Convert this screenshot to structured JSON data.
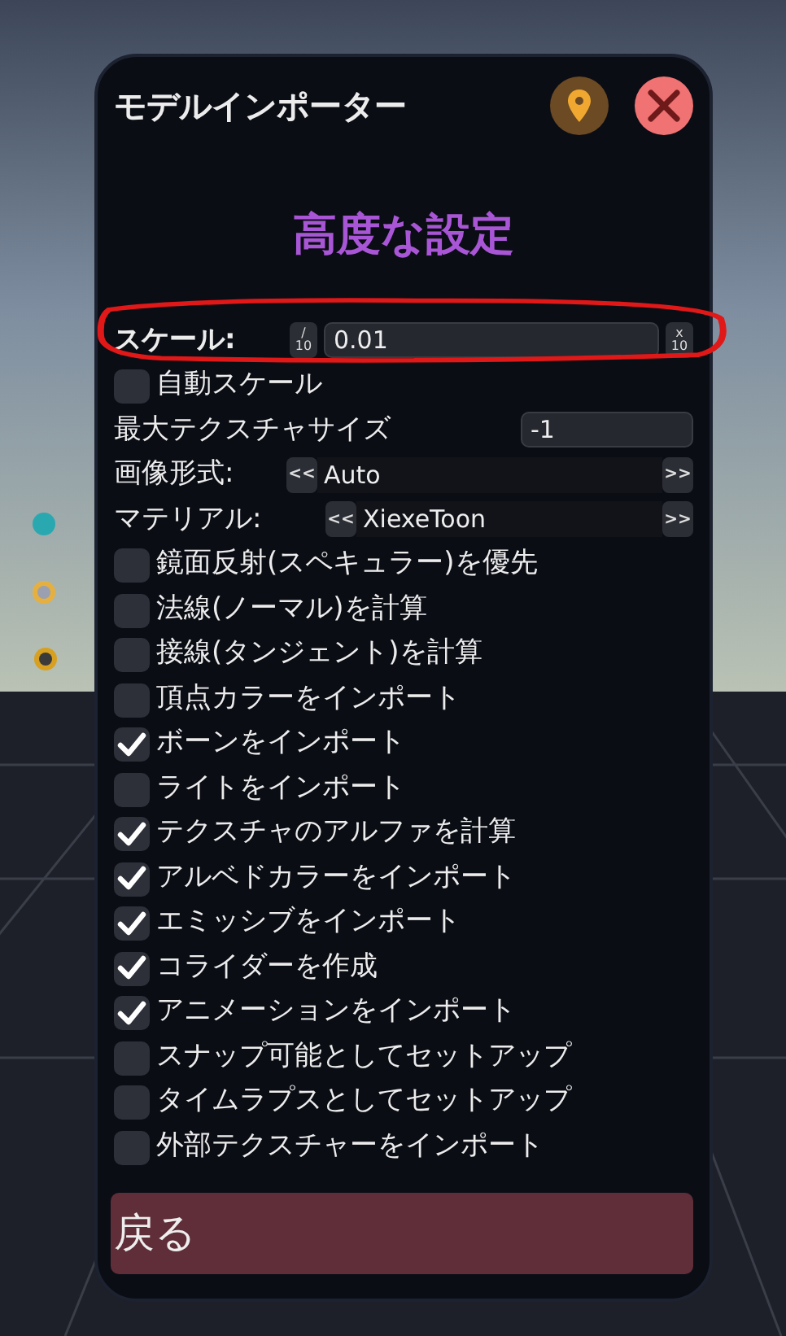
{
  "window": {
    "title": "モデルインポーター"
  },
  "heading": "高度な設定",
  "scale": {
    "label": "スケール:",
    "divide": {
      "symbol": "/",
      "factor": "10"
    },
    "value": "0.01",
    "multiply": {
      "symbol": "x",
      "factor": "10"
    }
  },
  "settings": [
    {
      "kind": "checkbox",
      "label": "自動スケール",
      "checked": false
    },
    {
      "kind": "number",
      "label": "最大テクスチャサイズ",
      "value": "-1"
    },
    {
      "kind": "selector",
      "label": "画像形式:",
      "value": "Auto",
      "prev": "<<",
      "next": ">>"
    },
    {
      "kind": "selector",
      "label": "マテリアル:",
      "value": "XiexeToon",
      "prev": "<<",
      "next": ">>"
    },
    {
      "kind": "checkbox",
      "label": "鏡面反射(スペキュラー)を優先",
      "checked": false
    },
    {
      "kind": "checkbox",
      "label": "法線(ノーマル)を計算",
      "checked": false
    },
    {
      "kind": "checkbox",
      "label": "接線(タンジェント)を計算",
      "checked": false
    },
    {
      "kind": "checkbox",
      "label": "頂点カラーをインポート",
      "checked": false
    },
    {
      "kind": "checkbox",
      "label": "ボーンをインポート",
      "checked": true
    },
    {
      "kind": "checkbox",
      "label": "ライトをインポート",
      "checked": false
    },
    {
      "kind": "checkbox",
      "label": "テクスチャのアルファを計算",
      "checked": true
    },
    {
      "kind": "checkbox",
      "label": "アルベドカラーをインポート",
      "checked": true
    },
    {
      "kind": "checkbox",
      "label": "エミッシブをインポート",
      "checked": true
    },
    {
      "kind": "checkbox",
      "label": "コライダーを作成",
      "checked": true
    },
    {
      "kind": "checkbox",
      "label": "アニメーションをインポート",
      "checked": true
    },
    {
      "kind": "checkbox",
      "label": "スナップ可能としてセットアップ",
      "checked": false
    },
    {
      "kind": "checkbox",
      "label": "タイムラプスとしてセットアップ",
      "checked": false
    },
    {
      "kind": "checkbox",
      "label": "外部テクスチャーをインポート",
      "checked": false
    }
  ],
  "back_button": "戻る"
}
